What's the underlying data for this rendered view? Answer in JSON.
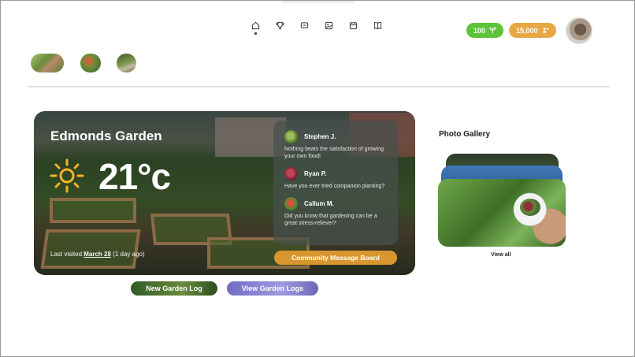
{
  "nav": {
    "items": [
      {
        "name": "home-icon",
        "active": true
      },
      {
        "name": "trophy-icon",
        "active": false
      },
      {
        "name": "message-icon",
        "active": false
      },
      {
        "name": "photo-icon",
        "active": false
      },
      {
        "name": "calendar-icon",
        "active": false
      },
      {
        "name": "book-icon",
        "active": false
      }
    ]
  },
  "stats": {
    "sprouts": "100",
    "points": "15,000"
  },
  "colors": {
    "green": "#5cc437",
    "orange": "#e7a843",
    "accent": "#d9962f"
  },
  "garden_card": {
    "title": "Edmonds Garden",
    "temperature": "21°c",
    "last_visited_prefix": "Last visited ",
    "last_visited_date": "March 28",
    "last_visited_suffix": " (1 day ago)",
    "comments": [
      {
        "name": "Stephen J.",
        "text": "Nothing beats the satisfaction of growing your own food!"
      },
      {
        "name": "Ryan P.",
        "text": "Have you ever tried companion planting?"
      },
      {
        "name": "Callum M.",
        "text": "Did you know that gardening can be a great stress-reliever?"
      }
    ],
    "board_button": "Community Message Board"
  },
  "actions": {
    "new_log": "New Garden Log",
    "view_logs": "View Garden Logs"
  },
  "gallery": {
    "title": "Photo Gallery",
    "view_all": "View all"
  }
}
